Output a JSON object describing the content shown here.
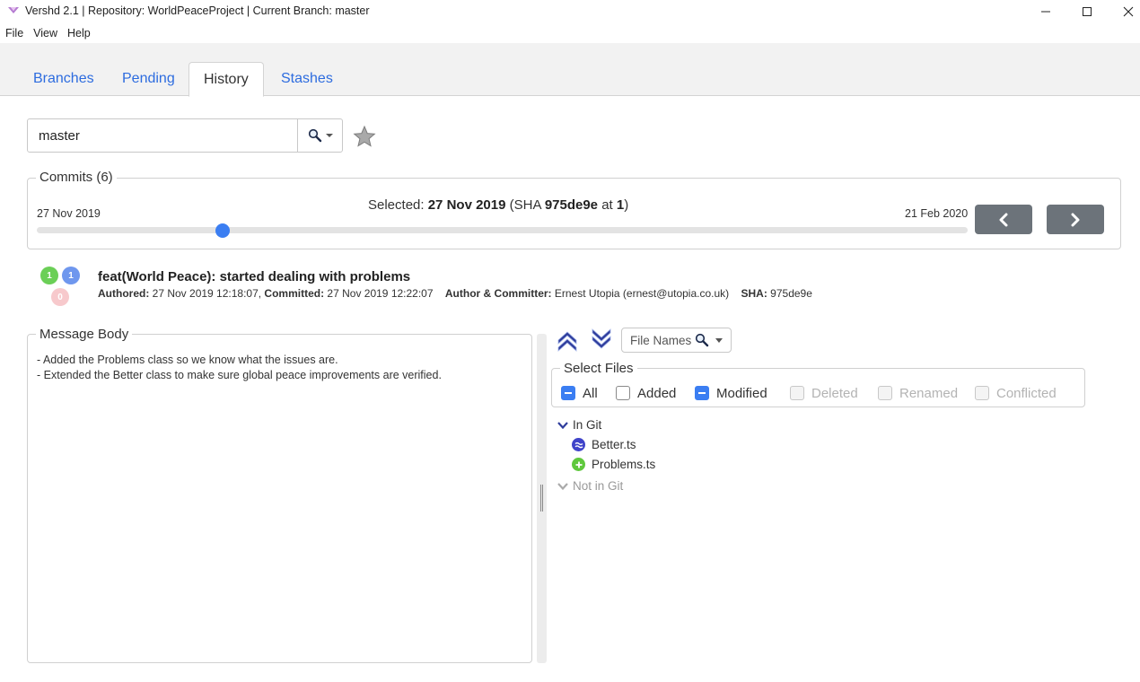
{
  "window": {
    "title": "Vershd 2.1 | Repository: WorldPeaceProject | Current Branch: master"
  },
  "menu": [
    "File",
    "View",
    "Help"
  ],
  "tabs": [
    {
      "label": "Branches",
      "active": false
    },
    {
      "label": "Pending",
      "active": false
    },
    {
      "label": "History",
      "active": true
    },
    {
      "label": "Stashes",
      "active": false
    }
  ],
  "branch_selector": {
    "value": "master",
    "search_icon": "magnifier-icon",
    "favorite_icon": "star-icon"
  },
  "commits": {
    "legend": "Commits (6)",
    "start_date": "27 Nov 2019",
    "end_date": "21 Feb 2020",
    "selected_prefix": "Selected: ",
    "selected_date": "27 Nov 2019",
    "selected_sha_prefix": " (SHA ",
    "selected_sha": "975de9e",
    "selected_at": " at ",
    "selected_index": "1",
    "selected_suffix": ")",
    "slider_position": 0.2
  },
  "commit": {
    "badges": {
      "added": "1",
      "modified": "1",
      "deleted": "0"
    },
    "title": "feat(World Peace): started dealing with problems",
    "authored_label": "Authored:",
    "authored_value": " 27 Nov 2019 12:18:07,",
    "committed_label": " Committed:",
    "committed_value": " 27 Nov 2019 12:22:07",
    "author_label": "Author & Committer:",
    "author_value": " Ernest Utopia (ernest@utopia.co.uk)",
    "sha_label": "SHA:",
    "sha_value": " 975de9e"
  },
  "message_body": {
    "legend": "Message Body",
    "lines": [
      "- Added the Problems class so we know what the issues are.",
      "- Extended the Better class to make sure global peace improvements are verified."
    ]
  },
  "file_filter": {
    "label": "File Names"
  },
  "select_files": {
    "legend": "Select Files",
    "options": [
      {
        "label": "All",
        "state": "indeterminate",
        "enabled": true
      },
      {
        "label": "Added",
        "state": "unchecked",
        "enabled": true
      },
      {
        "label": "Modified",
        "state": "indeterminate",
        "enabled": true
      },
      {
        "label": "Deleted",
        "state": "unchecked",
        "enabled": false
      },
      {
        "label": "Renamed",
        "state": "unchecked",
        "enabled": false
      },
      {
        "label": "Conflicted",
        "state": "unchecked",
        "enabled": false
      }
    ]
  },
  "tree": {
    "in_git": "In Git",
    "files": [
      {
        "name": "Better.ts",
        "status": "modified"
      },
      {
        "name": "Problems.ts",
        "status": "added"
      }
    ],
    "not_in_git": "Not in Git"
  },
  "colors": {
    "accent": "#3b7ef2",
    "tab_link": "#2d6cdf",
    "added": "#5fc83d",
    "modified": "#3f43c9",
    "nav_button": "#6c737a"
  }
}
